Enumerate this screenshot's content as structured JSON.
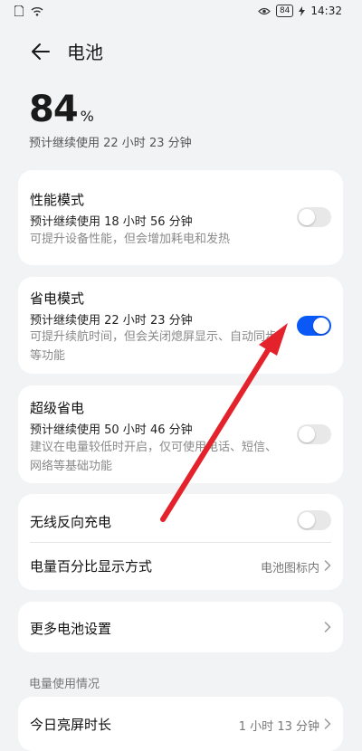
{
  "status_bar": {
    "battery_badge": "84",
    "time": "14:32",
    "icons": [
      "sim-icon",
      "wifi-icon",
      "eye-icon",
      "charging-bolt-icon"
    ]
  },
  "header": {
    "title": "电池",
    "back_icon": "arrow-left-icon"
  },
  "battery": {
    "percent": "84",
    "unit": "%",
    "remaining": "预计继续使用 22 小时 23 分钟"
  },
  "modes": [
    {
      "title": "性能模式",
      "remaining": "预计继续使用 18 小时 56 分钟",
      "desc": "可提升设备性能，但会增加耗电和发热",
      "enabled": false
    },
    {
      "title": "省电模式",
      "remaining": "预计继续使用 22 小时 23 分钟",
      "desc": "可提升续航时间，但会关闭熄屏显示、自动同步等功能",
      "enabled": true
    },
    {
      "title": "超级省电",
      "remaining": "预计继续使用 50 小时 46 分钟",
      "desc": "建议在电量较低时开启，仅可使用电话、短信、网络等基础功能",
      "enabled": false
    }
  ],
  "wireless_reverse_charge": {
    "label": "无线反向充电",
    "enabled": false
  },
  "percent_display": {
    "label": "电量百分比显示方式",
    "value": "电池图标内"
  },
  "more_settings": {
    "label": "更多电池设置"
  },
  "usage_section": {
    "label": "电量使用情况",
    "screen_on_label": "今日亮屏时长",
    "screen_on_value": "1 小时 13 分钟"
  },
  "colors": {
    "accent": "#0a59f7",
    "annotation_arrow": "#e3222b",
    "background": "#f1f3f5"
  }
}
